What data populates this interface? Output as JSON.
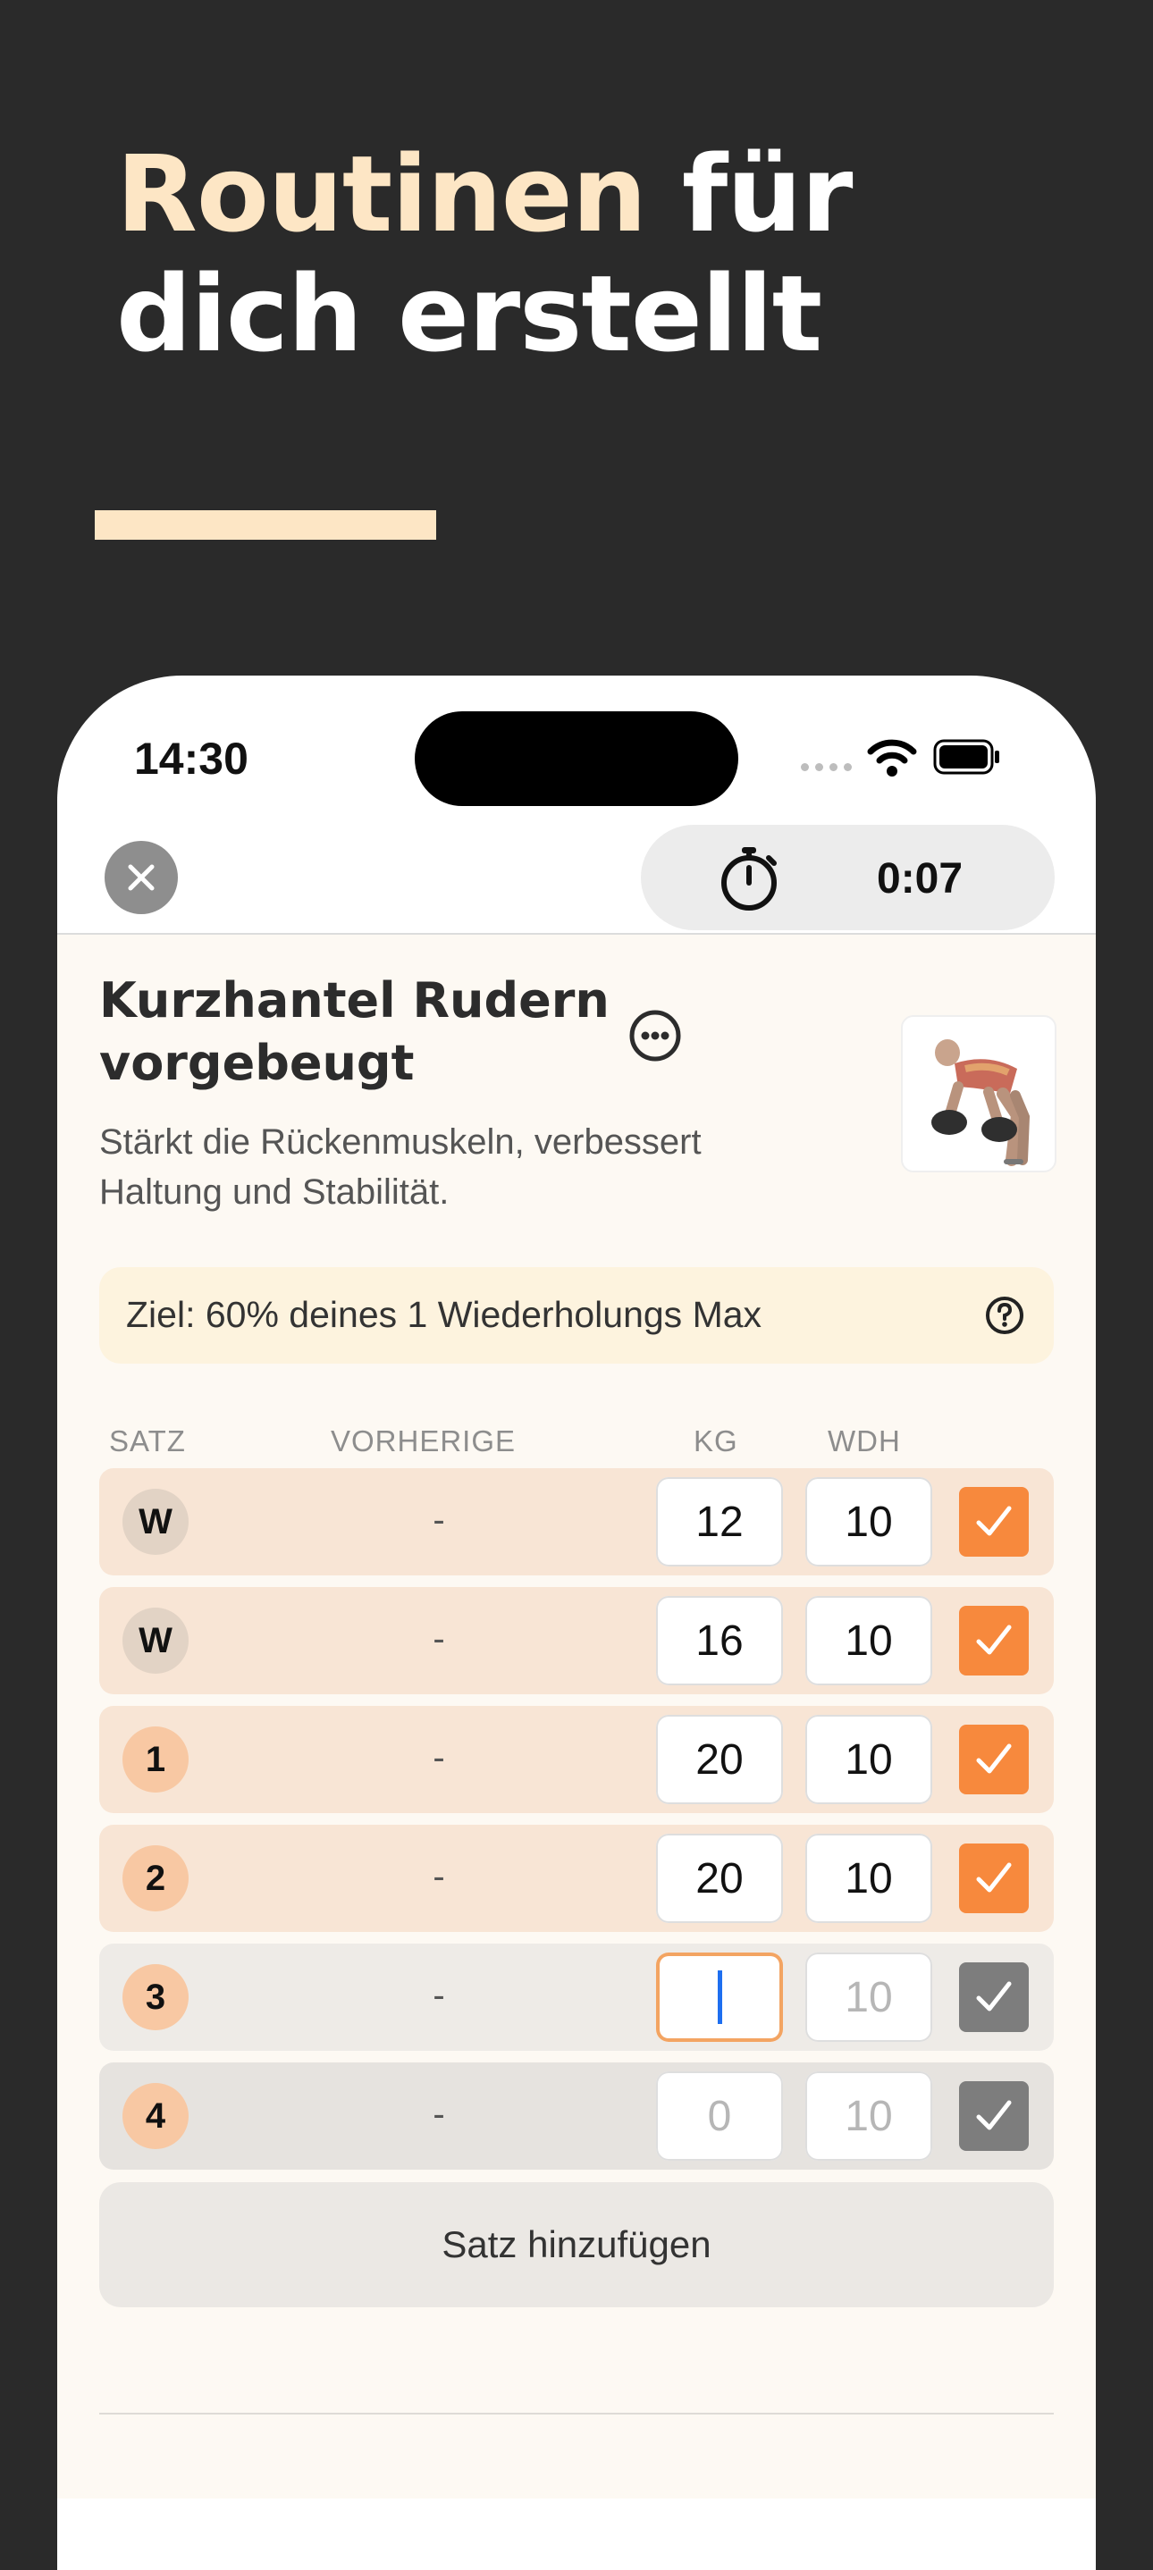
{
  "promo": {
    "headline_accent": "Routinen",
    "headline_rest_1": " für",
    "headline_line2": "dich erstellt"
  },
  "status_bar": {
    "time": "14:30",
    "icons": [
      "signal-icon",
      "wifi-icon",
      "battery-icon"
    ]
  },
  "toolbar": {
    "close_icon": "close-icon",
    "timer_icon": "stopwatch-icon",
    "timer_value": "0:07"
  },
  "exercise": {
    "title_line1": "Kurzhantel Rudern",
    "title_line2": "vorgebeugt",
    "description_line1": "Stärkt die Rückenmuskeln, verbessert",
    "description_line2": "Haltung und Stabilität.",
    "goal_text": "Ziel: 60% deines 1 Wiederholungs Max"
  },
  "table": {
    "headers": {
      "set": "SATZ",
      "previous": "VORHERIGE",
      "kg": "KG",
      "reps": "WDH"
    },
    "rows": [
      {
        "set": "W",
        "previous": "-",
        "kg": "12",
        "reps": "10",
        "done": true
      },
      {
        "set": "W",
        "previous": "-",
        "kg": "16",
        "reps": "10",
        "done": true
      },
      {
        "set": "1",
        "previous": "-",
        "kg": "20",
        "reps": "10",
        "done": true
      },
      {
        "set": "2",
        "previous": "-",
        "kg": "20",
        "reps": "10",
        "done": true
      },
      {
        "set": "3",
        "previous": "-",
        "kg": "",
        "reps": "10",
        "done": false
      },
      {
        "set": "4",
        "previous": "-",
        "kg": "0",
        "reps": "10",
        "done": false
      }
    ]
  },
  "add_set_label": "Satz hinzufügen",
  "colors": {
    "accent": "#f7893d",
    "headline_accent": "#fde6c5",
    "background": "#2a2a2a"
  }
}
